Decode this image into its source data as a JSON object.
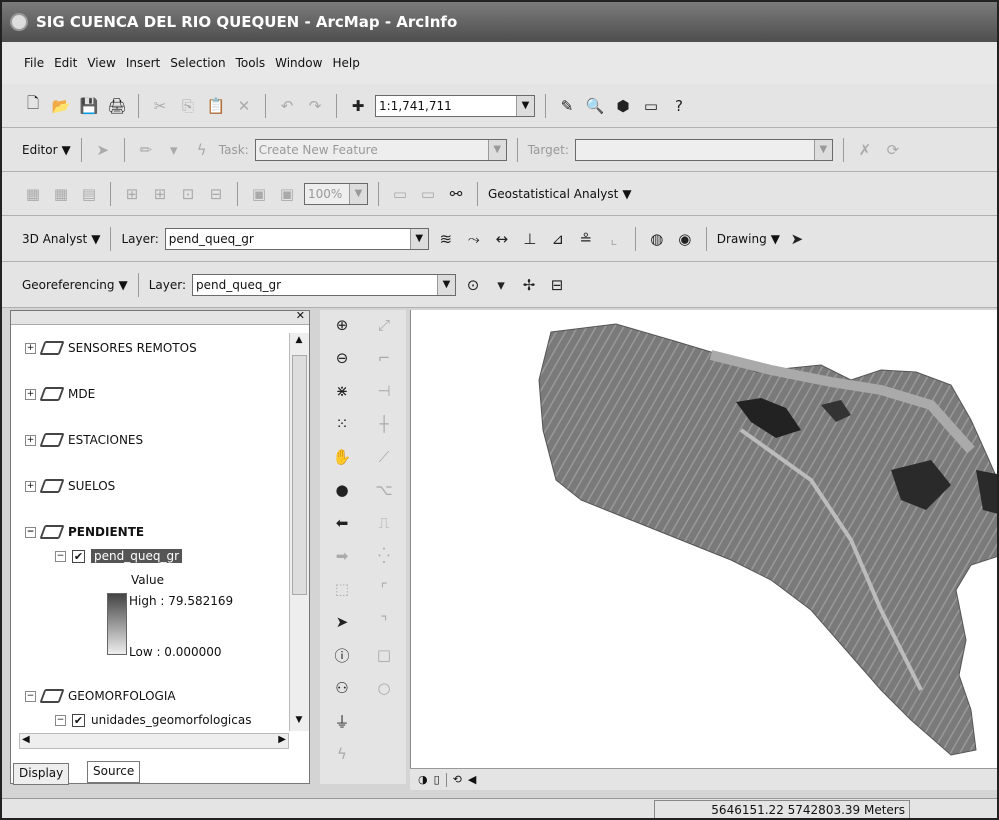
{
  "window": {
    "title": "SIG CUENCA DEL RIO QUEQUEN - ArcMap - ArcInfo"
  },
  "menu": [
    "File",
    "Edit",
    "View",
    "Insert",
    "Selection",
    "Tools",
    "Window",
    "Help"
  ],
  "standard": {
    "scale": "1:1,741,711"
  },
  "editor": {
    "label": "Editor",
    "task_label": "Task:",
    "task_value": "Create New Feature",
    "target_label": "Target:"
  },
  "georaster": {
    "zoom": "100%",
    "geostat": "Geostatistical Analyst"
  },
  "analyst3d": {
    "label": "3D Analyst",
    "layer_label": "Layer:",
    "layer_value": "pend_queq_gr",
    "drawing": "Drawing"
  },
  "georef": {
    "label": "Georeferencing",
    "layer_label": "Layer:",
    "layer_value": "pend_queq_gr"
  },
  "toc": {
    "groups": [
      "SENSORES REMOTOS",
      "MDE",
      "ESTACIONES",
      "SUELOS",
      "PENDIENTE",
      "GEOMORFOLOGIA"
    ],
    "layer": "pend_queq_gr",
    "legend_title": "Value",
    "high": "High : 79.582169",
    "low": "Low : 0.000000",
    "sublayer": "unidades_geomorfologicas",
    "tabs": [
      "Display",
      "Source"
    ]
  },
  "status": {
    "coords": "5646151.22  5742803.39 Meters"
  },
  "icons": [
    "new-icon",
    "open-icon",
    "save-icon",
    "print-icon",
    "cut-icon",
    "copy-icon",
    "paste-icon",
    "delete-icon",
    "undo-icon",
    "redo-icon",
    "add-data-icon",
    "zoom-in-icon",
    "zoom-out-icon",
    "pan-icon",
    "full-extent-icon",
    "back-icon",
    "forward-icon",
    "select-icon",
    "identify-icon",
    "find-icon",
    "measure-icon",
    "hyperlink-icon"
  ]
}
